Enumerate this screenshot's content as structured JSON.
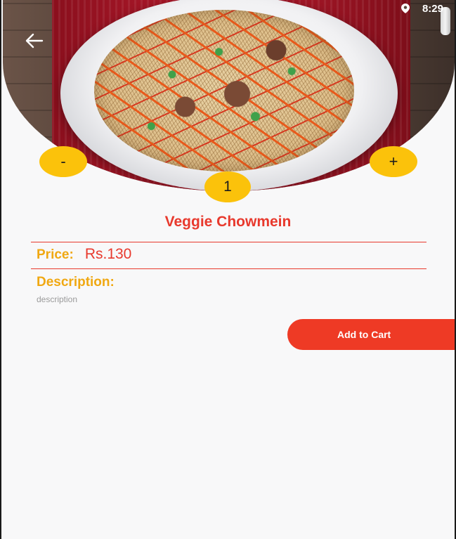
{
  "status_bar": {
    "time": "8:29",
    "icon": "location-pin-icon"
  },
  "header": {
    "back_icon": "arrow-left-icon"
  },
  "quantity": {
    "decrement_label": "-",
    "increment_label": "+",
    "value": "1"
  },
  "product": {
    "name": "Veggie Chowmein",
    "price_label": "Price:",
    "price_value": "Rs.130",
    "description_label": "Description:",
    "description_text": "description"
  },
  "actions": {
    "add_to_cart_label": "Add to Cart"
  },
  "colors": {
    "accent_red": "#ee3a25",
    "accent_yellow": "#fbc20b",
    "label_orange": "#f0a812"
  }
}
